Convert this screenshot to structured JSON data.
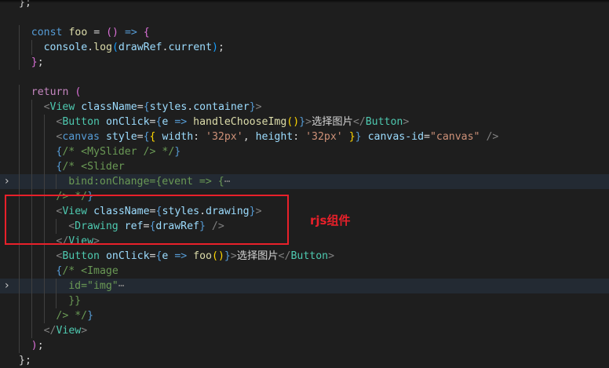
{
  "annotation": {
    "label": "rjs组件",
    "color": "#e8202a"
  },
  "theme": {
    "background": "#1e1e1e",
    "highlight_line": "#232a33"
  },
  "lines": [
    {
      "indent": 0,
      "tokens": [
        [
          "t-punc",
          "};"
        ]
      ]
    },
    {
      "indent": 0,
      "tokens": []
    },
    {
      "indent": 1,
      "tokens": [
        [
          "t-kw",
          "const"
        ],
        [
          "t-punc",
          " "
        ],
        [
          "t-fn",
          "foo"
        ],
        [
          "t-punc",
          " = "
        ],
        [
          "t-bracket-p",
          "()"
        ],
        [
          "t-punc",
          " "
        ],
        [
          "t-kw",
          "=>"
        ],
        [
          "t-punc",
          " "
        ],
        [
          "t-bracket-p",
          "{"
        ]
      ]
    },
    {
      "indent": 2,
      "tokens": [
        [
          "t-var",
          "console"
        ],
        [
          "t-punc",
          "."
        ],
        [
          "t-fn",
          "log"
        ],
        [
          "t-bracket-b",
          "("
        ],
        [
          "t-var",
          "drawRef"
        ],
        [
          "t-punc",
          "."
        ],
        [
          "t-var",
          "current"
        ],
        [
          "t-bracket-b",
          ")"
        ],
        [
          "t-punc",
          ";"
        ]
      ]
    },
    {
      "indent": 1,
      "tokens": [
        [
          "t-bracket-p",
          "}"
        ],
        [
          "t-punc",
          ";"
        ]
      ]
    },
    {
      "indent": 0,
      "tokens": []
    },
    {
      "indent": 1,
      "tokens": [
        [
          "t-ctl",
          "return"
        ],
        [
          "t-punc",
          " "
        ],
        [
          "t-bracket-p",
          "("
        ]
      ]
    },
    {
      "indent": 2,
      "tokens": [
        [
          "t-ang",
          "<"
        ],
        [
          "t-tag",
          "View"
        ],
        [
          "t-punc",
          " "
        ],
        [
          "t-var",
          "className"
        ],
        [
          "t-punc",
          "="
        ],
        [
          "t-kw",
          "{"
        ],
        [
          "t-var",
          "styles"
        ],
        [
          "t-punc",
          "."
        ],
        [
          "t-var",
          "container"
        ],
        [
          "t-kw",
          "}"
        ],
        [
          "t-ang",
          ">"
        ]
      ]
    },
    {
      "indent": 3,
      "tokens": [
        [
          "t-ang",
          "<"
        ],
        [
          "t-tag",
          "Button"
        ],
        [
          "t-punc",
          " "
        ],
        [
          "t-var",
          "onClick"
        ],
        [
          "t-punc",
          "="
        ],
        [
          "t-kw",
          "{"
        ],
        [
          "t-var",
          "e"
        ],
        [
          "t-punc",
          " "
        ],
        [
          "t-kw",
          "=>"
        ],
        [
          "t-punc",
          " "
        ],
        [
          "t-fn",
          "handleChooseImg"
        ],
        [
          "t-bracket-y",
          "()"
        ],
        [
          "t-kw",
          "}"
        ],
        [
          "t-ang",
          ">"
        ],
        [
          "t-text",
          "选择图片"
        ],
        [
          "t-ang",
          "</"
        ],
        [
          "t-tag",
          "Button"
        ],
        [
          "t-ang",
          ">"
        ]
      ]
    },
    {
      "indent": 3,
      "tokens": [
        [
          "t-ang",
          "<"
        ],
        [
          "t-kw",
          "canvas"
        ],
        [
          "t-punc",
          " "
        ],
        [
          "t-var",
          "style"
        ],
        [
          "t-punc",
          "="
        ],
        [
          "t-kw",
          "{"
        ],
        [
          "t-bracket-y",
          "{"
        ],
        [
          "t-punc",
          " "
        ],
        [
          "t-var",
          "width"
        ],
        [
          "t-punc",
          ": "
        ],
        [
          "t-str",
          "'32px'"
        ],
        [
          "t-punc",
          ", "
        ],
        [
          "t-var",
          "height"
        ],
        [
          "t-punc",
          ": "
        ],
        [
          "t-str",
          "'32px'"
        ],
        [
          "t-punc",
          " "
        ],
        [
          "t-bracket-y",
          "}"
        ],
        [
          "t-kw",
          "}"
        ],
        [
          "t-punc",
          " "
        ],
        [
          "t-var",
          "canvas-id"
        ],
        [
          "t-punc",
          "="
        ],
        [
          "t-str",
          "\"canvas\""
        ],
        [
          "t-punc",
          " "
        ],
        [
          "t-ang",
          "/>"
        ]
      ]
    },
    {
      "indent": 3,
      "tokens": [
        [
          "t-kw",
          "{"
        ],
        [
          "t-cm",
          "/* <MySlider /> */"
        ],
        [
          "t-kw",
          "}"
        ]
      ]
    },
    {
      "indent": 3,
      "tokens": [
        [
          "t-kw",
          "{"
        ],
        [
          "t-cm",
          "/* <Slider"
        ]
      ]
    },
    {
      "indent": 4,
      "fold": true,
      "highlight": true,
      "tokens": [
        [
          "t-cm",
          "bind:onChange={event => {"
        ],
        [
          "t-ell",
          "⋯"
        ]
      ]
    },
    {
      "indent": 3,
      "tokens": [
        [
          "t-cm",
          "/> */"
        ],
        [
          "t-kw",
          "}"
        ]
      ]
    },
    {
      "indent": 3,
      "tokens": [
        [
          "t-ang",
          "<"
        ],
        [
          "t-tag",
          "View"
        ],
        [
          "t-punc",
          " "
        ],
        [
          "t-var",
          "className"
        ],
        [
          "t-punc",
          "="
        ],
        [
          "t-kw",
          "{"
        ],
        [
          "t-var",
          "styles"
        ],
        [
          "t-punc",
          "."
        ],
        [
          "t-var",
          "drawing"
        ],
        [
          "t-kw",
          "}"
        ],
        [
          "t-ang",
          ">"
        ]
      ]
    },
    {
      "indent": 4,
      "tokens": [
        [
          "t-ang",
          "<"
        ],
        [
          "t-tag",
          "Drawing"
        ],
        [
          "t-punc",
          " "
        ],
        [
          "t-var",
          "ref"
        ],
        [
          "t-punc",
          "="
        ],
        [
          "t-kw",
          "{"
        ],
        [
          "t-var",
          "drawRef"
        ],
        [
          "t-kw",
          "}"
        ],
        [
          "t-punc",
          " "
        ],
        [
          "t-ang",
          "/>"
        ]
      ]
    },
    {
      "indent": 3,
      "tokens": [
        [
          "t-ang",
          "</"
        ],
        [
          "t-tag",
          "View"
        ],
        [
          "t-ang",
          ">"
        ]
      ]
    },
    {
      "indent": 3,
      "tokens": [
        [
          "t-ang",
          "<"
        ],
        [
          "t-tag",
          "Button"
        ],
        [
          "t-punc",
          " "
        ],
        [
          "t-var",
          "onClick"
        ],
        [
          "t-punc",
          "="
        ],
        [
          "t-kw",
          "{"
        ],
        [
          "t-var",
          "e"
        ],
        [
          "t-punc",
          " "
        ],
        [
          "t-kw",
          "=>"
        ],
        [
          "t-punc",
          " "
        ],
        [
          "t-fn",
          "foo"
        ],
        [
          "t-bracket-y",
          "()"
        ],
        [
          "t-kw",
          "}"
        ],
        [
          "t-ang",
          ">"
        ],
        [
          "t-text",
          "选择图片"
        ],
        [
          "t-ang",
          "</"
        ],
        [
          "t-tag",
          "Button"
        ],
        [
          "t-ang",
          ">"
        ]
      ]
    },
    {
      "indent": 3,
      "tokens": [
        [
          "t-kw",
          "{"
        ],
        [
          "t-cm",
          "/* <Image"
        ]
      ]
    },
    {
      "indent": 4,
      "fold": true,
      "highlight": true,
      "tokens": [
        [
          "t-cm",
          "id=\"img\""
        ],
        [
          "t-ell",
          "⋯"
        ]
      ]
    },
    {
      "indent": 4,
      "tokens": [
        [
          "t-cm",
          "}}"
        ]
      ]
    },
    {
      "indent": 3,
      "tokens": [
        [
          "t-cm",
          "/> */"
        ],
        [
          "t-kw",
          "}"
        ]
      ]
    },
    {
      "indent": 2,
      "tokens": [
        [
          "t-ang",
          "</"
        ],
        [
          "t-tag",
          "View"
        ],
        [
          "t-ang",
          ">"
        ]
      ]
    },
    {
      "indent": 1,
      "tokens": [
        [
          "t-bracket-p",
          ")"
        ],
        [
          "t-punc",
          ";"
        ]
      ]
    },
    {
      "indent": 0,
      "tokens": [
        [
          "t-punc",
          "};"
        ]
      ]
    }
  ]
}
